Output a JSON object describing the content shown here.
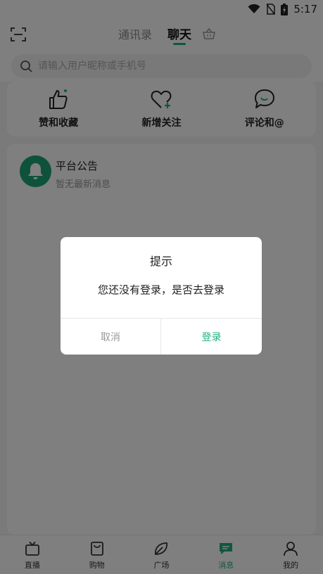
{
  "status_bar": {
    "time": "5:17",
    "icons": [
      "wifi-icon",
      "no-sim-icon",
      "battery-charging-icon"
    ]
  },
  "header": {
    "tabs": [
      {
        "label": "通讯录",
        "active": false
      },
      {
        "label": "聊天",
        "active": true
      }
    ],
    "left_icon": "scan-icon",
    "right_icon": "basket-icon"
  },
  "search": {
    "placeholder": "请输入用户昵称或手机号",
    "value": ""
  },
  "quick_actions": [
    {
      "label": "赞和收藏",
      "icon": "thumbs-up-icon"
    },
    {
      "label": "新增关注",
      "icon": "heart-plus-icon"
    },
    {
      "label": "评论和@",
      "icon": "comment-icon"
    }
  ],
  "notice": {
    "title": "平台公告",
    "subtitle": "暂无最新消息",
    "icon": "bell-icon"
  },
  "dialog": {
    "title": "提示",
    "message": "您还没有登录，是否去登录",
    "cancel_label": "取消",
    "confirm_label": "登录"
  },
  "tabbar": [
    {
      "label": "直播",
      "icon": "tv-icon",
      "active": false
    },
    {
      "label": "购物",
      "icon": "shopping-bag-icon",
      "active": false
    },
    {
      "label": "广场",
      "icon": "leaf-icon",
      "active": false
    },
    {
      "label": "消息",
      "icon": "message-icon",
      "active": true
    },
    {
      "label": "我的",
      "icon": "user-icon",
      "active": false
    }
  ],
  "colors": {
    "accent": "#1fb07a",
    "overlay": "rgba(0,0,0,0.5)"
  }
}
